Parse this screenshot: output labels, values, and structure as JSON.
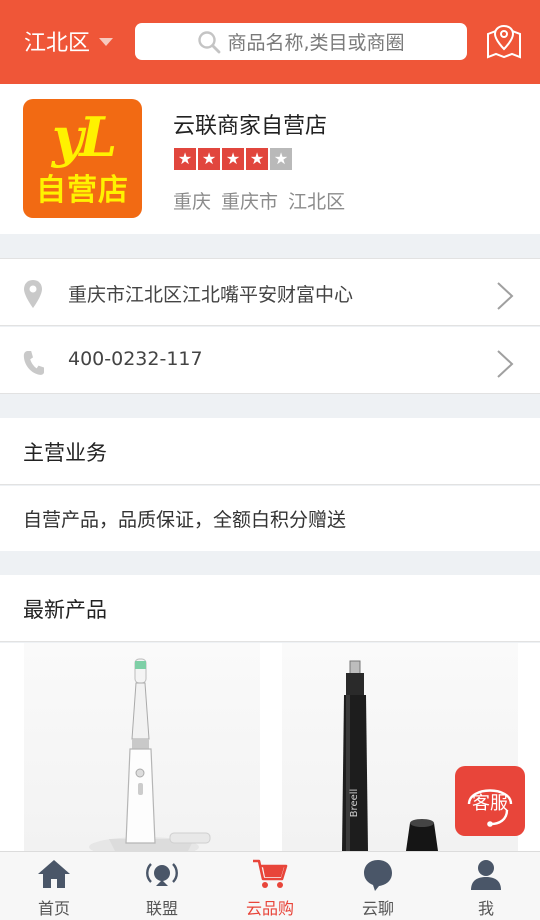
{
  "header": {
    "district": "江北区",
    "search_placeholder": "商品名称,类目或商圈",
    "accent_color": "#ef5638"
  },
  "shop": {
    "logo_text_latin": "yL",
    "logo_text_cn": "自营店",
    "name": "云联商家自营店",
    "rating": 4,
    "rating_max": 5,
    "location": "重庆 重庆市 江北区"
  },
  "contact": {
    "address": "重庆市江北区江北嘴平安财富中心",
    "phone": "400-0232-117"
  },
  "business": {
    "title": "主营业务",
    "description": "自营产品，品质保证，全额白积分赠送"
  },
  "latest": {
    "title": "最新产品",
    "products": [
      {
        "image": "electric-toothbrush"
      },
      {
        "image": "nose-hair-trimmer",
        "brand": "Breell"
      }
    ]
  },
  "service_button": {
    "label": "客服"
  },
  "tabbar": {
    "active_index": 2,
    "tabs": [
      {
        "label": "首页",
        "icon": "home-icon"
      },
      {
        "label": "联盟",
        "icon": "alliance-icon"
      },
      {
        "label": "云品购",
        "icon": "cart-icon"
      },
      {
        "label": "云聊",
        "icon": "chat-icon"
      },
      {
        "label": "我",
        "icon": "user-icon"
      }
    ]
  }
}
